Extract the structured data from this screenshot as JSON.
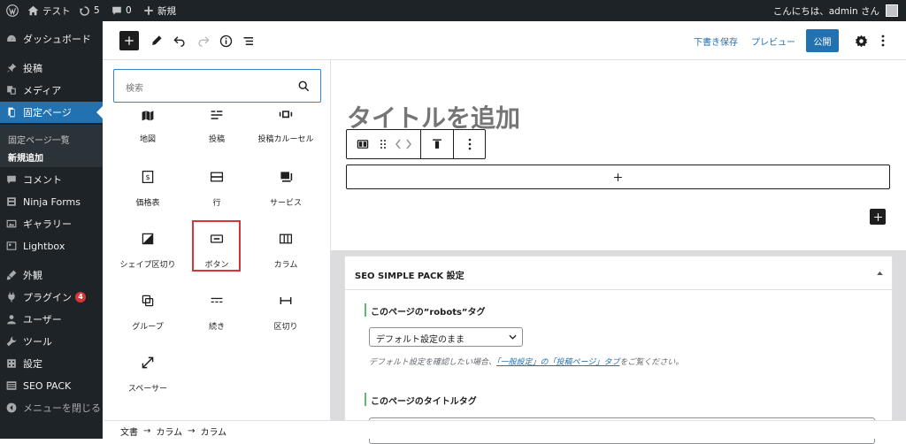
{
  "admin_bar": {
    "site_name": "テスト",
    "updates_count": "5",
    "comments_count": "0",
    "new_label": "新規",
    "greeting": "こんにちは、admin さん"
  },
  "sidebar": {
    "items": [
      {
        "label": "ダッシュボード",
        "icon": "dashboard-icon"
      },
      {
        "label": "投稿",
        "icon": "pin-icon"
      },
      {
        "label": "メディア",
        "icon": "media-icon"
      },
      {
        "label": "固定ページ",
        "icon": "page-icon"
      },
      {
        "label": "コメント",
        "icon": "comment-icon"
      },
      {
        "label": "Ninja Forms",
        "icon": "form-icon"
      },
      {
        "label": "ギャラリー",
        "icon": "gallery-icon"
      },
      {
        "label": "Lightbox",
        "icon": "lightbox-icon"
      },
      {
        "label": "外観",
        "icon": "brush-icon"
      },
      {
        "label": "プラグイン",
        "icon": "plugin-icon",
        "badge": "4"
      },
      {
        "label": "ユーザー",
        "icon": "user-icon"
      },
      {
        "label": "ツール",
        "icon": "wrench-icon"
      },
      {
        "label": "設定",
        "icon": "settings-icon"
      },
      {
        "label": "SEO PACK",
        "icon": "list-icon"
      },
      {
        "label": "メニューを閉じる",
        "icon": "collapse-icon"
      }
    ],
    "submenu": [
      "固定ページ一覧",
      "新規追加"
    ]
  },
  "toolbar": {
    "save_draft": "下書き保存",
    "preview": "プレビュー",
    "publish": "公開"
  },
  "inserter": {
    "search_placeholder": "検索",
    "blocks": [
      {
        "label": "地図",
        "icon": "map-icon"
      },
      {
        "label": "投稿",
        "icon": "posts-icon"
      },
      {
        "label": "投稿カルーセル",
        "icon": "carousel-icon"
      },
      {
        "label": "価格表",
        "icon": "price-table-icon"
      },
      {
        "label": "行",
        "icon": "row-icon"
      },
      {
        "label": "サービス",
        "icon": "service-icon"
      },
      {
        "label": "シェイプ区切り",
        "icon": "shape-divider-icon"
      },
      {
        "label": "ボタン",
        "icon": "button-icon"
      },
      {
        "label": "カラム",
        "icon": "columns-icon"
      },
      {
        "label": "グループ",
        "icon": "group-icon"
      },
      {
        "label": "続き",
        "icon": "more-icon"
      },
      {
        "label": "区切り",
        "icon": "separator-icon"
      },
      {
        "label": "スペーサー",
        "icon": "spacer-icon"
      }
    ]
  },
  "editor": {
    "title_placeholder": "タイトルを追加"
  },
  "seo": {
    "title": "SEO SIMPLE PACK 設定",
    "robots_label": "このページの”robots”タグ",
    "robots_value": "デフォルト設定のまま",
    "help_prefix": "デフォルト設定を確認したい場合、",
    "help_link": "「一般設定」の「投稿ページ」タブ",
    "help_suffix": "をご覧ください。",
    "title_tag_label": "このページのタイトルタグ"
  },
  "breadcrumb": [
    "文書",
    "カラム",
    "カラム"
  ],
  "colors": {
    "accent": "#2271b1",
    "admin_bg": "#1d2327",
    "highlight": "#d63638"
  }
}
